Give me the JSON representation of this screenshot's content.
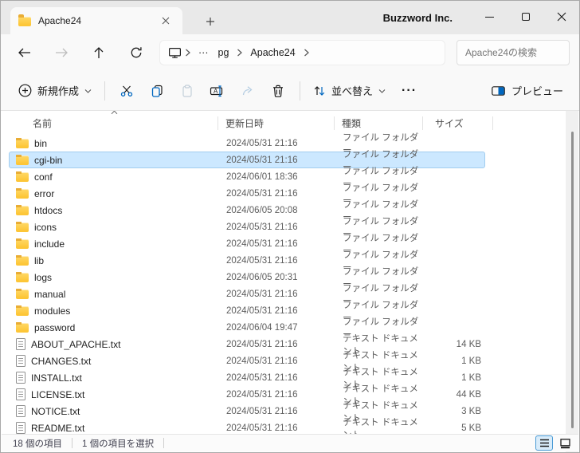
{
  "window": {
    "tab_title": "Apache24",
    "brand": "Buzzword Inc."
  },
  "nav": {
    "breadcrumb": {
      "ellipsis": "···",
      "items": [
        "pg",
        "Apache24"
      ]
    },
    "search_placeholder": "Apache24の検索"
  },
  "toolbar": {
    "new_label": "新規作成",
    "sort_label": "並べ替え",
    "more_label": "···",
    "preview_label": "プレビュー"
  },
  "icons": {
    "tab": "folder-icon",
    "nav": [
      "arrow-left",
      "arrow-right",
      "arrow-up",
      "refresh"
    ],
    "breadcrumb_device": "monitor-icon",
    "toolbar": [
      "circle-plus",
      "scissors-cut",
      "copy",
      "clipboard-paste",
      "rename",
      "share",
      "trash-delete",
      "sort-arrows",
      "split-panel-preview"
    ],
    "statusbar_views": [
      "details-view",
      "thumbnail-view"
    ]
  },
  "list": {
    "columns": {
      "name": "名前",
      "modified": "更新日時",
      "type": "種類",
      "size": "サイズ"
    },
    "rows": [
      {
        "name": "bin",
        "modified": "2024/05/31 21:16",
        "type": "ファイル フォルダー",
        "size": "",
        "kind": "folder",
        "selected": false
      },
      {
        "name": "cgi-bin",
        "modified": "2024/05/31 21:16",
        "type": "ファイル フォルダー",
        "size": "",
        "kind": "folder",
        "selected": true
      },
      {
        "name": "conf",
        "modified": "2024/06/01 18:36",
        "type": "ファイル フォルダー",
        "size": "",
        "kind": "folder",
        "selected": false
      },
      {
        "name": "error",
        "modified": "2024/05/31 21:16",
        "type": "ファイル フォルダー",
        "size": "",
        "kind": "folder",
        "selected": false
      },
      {
        "name": "htdocs",
        "modified": "2024/06/05 20:08",
        "type": "ファイル フォルダー",
        "size": "",
        "kind": "folder",
        "selected": false
      },
      {
        "name": "icons",
        "modified": "2024/05/31 21:16",
        "type": "ファイル フォルダー",
        "size": "",
        "kind": "folder",
        "selected": false
      },
      {
        "name": "include",
        "modified": "2024/05/31 21:16",
        "type": "ファイル フォルダー",
        "size": "",
        "kind": "folder",
        "selected": false
      },
      {
        "name": "lib",
        "modified": "2024/05/31 21:16",
        "type": "ファイル フォルダー",
        "size": "",
        "kind": "folder",
        "selected": false
      },
      {
        "name": "logs",
        "modified": "2024/06/05 20:31",
        "type": "ファイル フォルダー",
        "size": "",
        "kind": "folder",
        "selected": false
      },
      {
        "name": "manual",
        "modified": "2024/05/31 21:16",
        "type": "ファイル フォルダー",
        "size": "",
        "kind": "folder",
        "selected": false
      },
      {
        "name": "modules",
        "modified": "2024/05/31 21:16",
        "type": "ファイル フォルダー",
        "size": "",
        "kind": "folder",
        "selected": false
      },
      {
        "name": "password",
        "modified": "2024/06/04 19:47",
        "type": "ファイル フォルダー",
        "size": "",
        "kind": "folder",
        "selected": false
      },
      {
        "name": "ABOUT_APACHE.txt",
        "modified": "2024/05/31 21:16",
        "type": "テキスト ドキュメント",
        "size": "14 KB",
        "kind": "text",
        "selected": false
      },
      {
        "name": "CHANGES.txt",
        "modified": "2024/05/31 21:16",
        "type": "テキスト ドキュメント",
        "size": "1 KB",
        "kind": "text",
        "selected": false
      },
      {
        "name": "INSTALL.txt",
        "modified": "2024/05/31 21:16",
        "type": "テキスト ドキュメント",
        "size": "1 KB",
        "kind": "text",
        "selected": false
      },
      {
        "name": "LICENSE.txt",
        "modified": "2024/05/31 21:16",
        "type": "テキスト ドキュメント",
        "size": "44 KB",
        "kind": "text",
        "selected": false
      },
      {
        "name": "NOTICE.txt",
        "modified": "2024/05/31 21:16",
        "type": "テキスト ドキュメント",
        "size": "3 KB",
        "kind": "text",
        "selected": false
      },
      {
        "name": "README.txt",
        "modified": "2024/05/31 21:16",
        "type": "テキスト ドキュメント",
        "size": "5 KB",
        "kind": "text",
        "selected": false
      }
    ]
  },
  "statusbar": {
    "items_count": "18 個の項目",
    "selection_count": "1 個の項目を選択"
  },
  "colors": {
    "accent": "#0067c0",
    "selection_bg": "#cce8ff",
    "selection_border": "#a2cdef",
    "titlebar_bg": "#e9e9e9",
    "chrome_bg": "#f9f9f9"
  }
}
